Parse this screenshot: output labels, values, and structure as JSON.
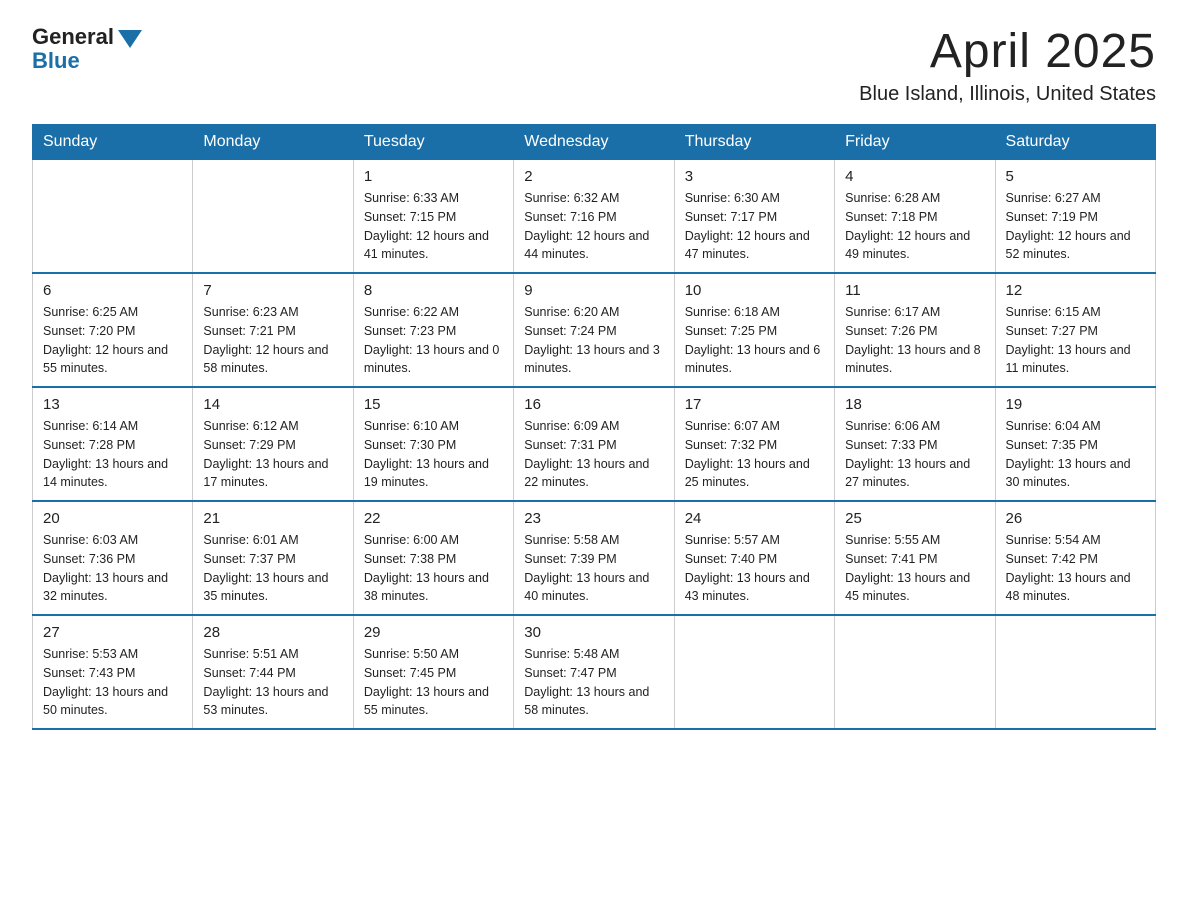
{
  "logo": {
    "general": "General",
    "blue": "Blue"
  },
  "title": "April 2025",
  "subtitle": "Blue Island, Illinois, United States",
  "days_of_week": [
    "Sunday",
    "Monday",
    "Tuesday",
    "Wednesday",
    "Thursday",
    "Friday",
    "Saturday"
  ],
  "weeks": [
    [
      {
        "day": "",
        "sunrise": "",
        "sunset": "",
        "daylight": ""
      },
      {
        "day": "",
        "sunrise": "",
        "sunset": "",
        "daylight": ""
      },
      {
        "day": "1",
        "sunrise": "Sunrise: 6:33 AM",
        "sunset": "Sunset: 7:15 PM",
        "daylight": "Daylight: 12 hours and 41 minutes."
      },
      {
        "day": "2",
        "sunrise": "Sunrise: 6:32 AM",
        "sunset": "Sunset: 7:16 PM",
        "daylight": "Daylight: 12 hours and 44 minutes."
      },
      {
        "day": "3",
        "sunrise": "Sunrise: 6:30 AM",
        "sunset": "Sunset: 7:17 PM",
        "daylight": "Daylight: 12 hours and 47 minutes."
      },
      {
        "day": "4",
        "sunrise": "Sunrise: 6:28 AM",
        "sunset": "Sunset: 7:18 PM",
        "daylight": "Daylight: 12 hours and 49 minutes."
      },
      {
        "day": "5",
        "sunrise": "Sunrise: 6:27 AM",
        "sunset": "Sunset: 7:19 PM",
        "daylight": "Daylight: 12 hours and 52 minutes."
      }
    ],
    [
      {
        "day": "6",
        "sunrise": "Sunrise: 6:25 AM",
        "sunset": "Sunset: 7:20 PM",
        "daylight": "Daylight: 12 hours and 55 minutes."
      },
      {
        "day": "7",
        "sunrise": "Sunrise: 6:23 AM",
        "sunset": "Sunset: 7:21 PM",
        "daylight": "Daylight: 12 hours and 58 minutes."
      },
      {
        "day": "8",
        "sunrise": "Sunrise: 6:22 AM",
        "sunset": "Sunset: 7:23 PM",
        "daylight": "Daylight: 13 hours and 0 minutes."
      },
      {
        "day": "9",
        "sunrise": "Sunrise: 6:20 AM",
        "sunset": "Sunset: 7:24 PM",
        "daylight": "Daylight: 13 hours and 3 minutes."
      },
      {
        "day": "10",
        "sunrise": "Sunrise: 6:18 AM",
        "sunset": "Sunset: 7:25 PM",
        "daylight": "Daylight: 13 hours and 6 minutes."
      },
      {
        "day": "11",
        "sunrise": "Sunrise: 6:17 AM",
        "sunset": "Sunset: 7:26 PM",
        "daylight": "Daylight: 13 hours and 8 minutes."
      },
      {
        "day": "12",
        "sunrise": "Sunrise: 6:15 AM",
        "sunset": "Sunset: 7:27 PM",
        "daylight": "Daylight: 13 hours and 11 minutes."
      }
    ],
    [
      {
        "day": "13",
        "sunrise": "Sunrise: 6:14 AM",
        "sunset": "Sunset: 7:28 PM",
        "daylight": "Daylight: 13 hours and 14 minutes."
      },
      {
        "day": "14",
        "sunrise": "Sunrise: 6:12 AM",
        "sunset": "Sunset: 7:29 PM",
        "daylight": "Daylight: 13 hours and 17 minutes."
      },
      {
        "day": "15",
        "sunrise": "Sunrise: 6:10 AM",
        "sunset": "Sunset: 7:30 PM",
        "daylight": "Daylight: 13 hours and 19 minutes."
      },
      {
        "day": "16",
        "sunrise": "Sunrise: 6:09 AM",
        "sunset": "Sunset: 7:31 PM",
        "daylight": "Daylight: 13 hours and 22 minutes."
      },
      {
        "day": "17",
        "sunrise": "Sunrise: 6:07 AM",
        "sunset": "Sunset: 7:32 PM",
        "daylight": "Daylight: 13 hours and 25 minutes."
      },
      {
        "day": "18",
        "sunrise": "Sunrise: 6:06 AM",
        "sunset": "Sunset: 7:33 PM",
        "daylight": "Daylight: 13 hours and 27 minutes."
      },
      {
        "day": "19",
        "sunrise": "Sunrise: 6:04 AM",
        "sunset": "Sunset: 7:35 PM",
        "daylight": "Daylight: 13 hours and 30 minutes."
      }
    ],
    [
      {
        "day": "20",
        "sunrise": "Sunrise: 6:03 AM",
        "sunset": "Sunset: 7:36 PM",
        "daylight": "Daylight: 13 hours and 32 minutes."
      },
      {
        "day": "21",
        "sunrise": "Sunrise: 6:01 AM",
        "sunset": "Sunset: 7:37 PM",
        "daylight": "Daylight: 13 hours and 35 minutes."
      },
      {
        "day": "22",
        "sunrise": "Sunrise: 6:00 AM",
        "sunset": "Sunset: 7:38 PM",
        "daylight": "Daylight: 13 hours and 38 minutes."
      },
      {
        "day": "23",
        "sunrise": "Sunrise: 5:58 AM",
        "sunset": "Sunset: 7:39 PM",
        "daylight": "Daylight: 13 hours and 40 minutes."
      },
      {
        "day": "24",
        "sunrise": "Sunrise: 5:57 AM",
        "sunset": "Sunset: 7:40 PM",
        "daylight": "Daylight: 13 hours and 43 minutes."
      },
      {
        "day": "25",
        "sunrise": "Sunrise: 5:55 AM",
        "sunset": "Sunset: 7:41 PM",
        "daylight": "Daylight: 13 hours and 45 minutes."
      },
      {
        "day": "26",
        "sunrise": "Sunrise: 5:54 AM",
        "sunset": "Sunset: 7:42 PM",
        "daylight": "Daylight: 13 hours and 48 minutes."
      }
    ],
    [
      {
        "day": "27",
        "sunrise": "Sunrise: 5:53 AM",
        "sunset": "Sunset: 7:43 PM",
        "daylight": "Daylight: 13 hours and 50 minutes."
      },
      {
        "day": "28",
        "sunrise": "Sunrise: 5:51 AM",
        "sunset": "Sunset: 7:44 PM",
        "daylight": "Daylight: 13 hours and 53 minutes."
      },
      {
        "day": "29",
        "sunrise": "Sunrise: 5:50 AM",
        "sunset": "Sunset: 7:45 PM",
        "daylight": "Daylight: 13 hours and 55 minutes."
      },
      {
        "day": "30",
        "sunrise": "Sunrise: 5:48 AM",
        "sunset": "Sunset: 7:47 PM",
        "daylight": "Daylight: 13 hours and 58 minutes."
      },
      {
        "day": "",
        "sunrise": "",
        "sunset": "",
        "daylight": ""
      },
      {
        "day": "",
        "sunrise": "",
        "sunset": "",
        "daylight": ""
      },
      {
        "day": "",
        "sunrise": "",
        "sunset": "",
        "daylight": ""
      }
    ]
  ]
}
